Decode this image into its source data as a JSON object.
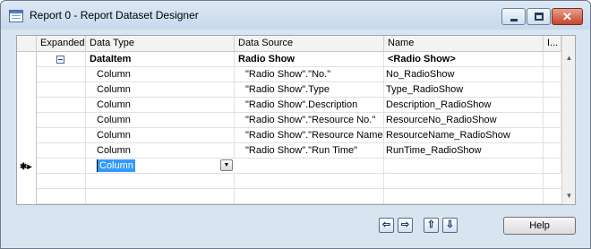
{
  "window": {
    "title": "Report 0 - Report Dataset Designer",
    "icons": {
      "app": "table-icon",
      "minimize": "minimize-icon",
      "maximize": "maximize-icon",
      "close": "close-icon"
    },
    "close_glyph": "✕"
  },
  "grid": {
    "columns": [
      "Expanded",
      "Data Type",
      "Data Source",
      "Name",
      "I..."
    ],
    "rows": [
      {
        "data_type": "DataItem",
        "data_source": "Radio Show",
        "name": "<Radio Show>",
        "expanded": true,
        "bold": true
      },
      {
        "data_type": "Column",
        "data_source": "\"Radio Show\".\"No.\"",
        "name": "No_RadioShow"
      },
      {
        "data_type": "Column",
        "data_source": "\"Radio Show\".Type",
        "name": "Type_RadioShow"
      },
      {
        "data_type": "Column",
        "data_source": "\"Radio Show\".Description",
        "name": "Description_RadioShow"
      },
      {
        "data_type": "Column",
        "data_source": "\"Radio Show\".\"Resource No.\"",
        "name": "ResourceNo_RadioShow"
      },
      {
        "data_type": "Column",
        "data_source": "\"Radio Show\".\"Resource Name\"",
        "name": "ResourceName_RadioShow"
      },
      {
        "data_type": "Column",
        "data_source": "\"Radio Show\".\"Run Time\"",
        "name": "RunTime_RadioShow"
      }
    ],
    "new_row": {
      "marker": "✱▸",
      "data_type": "Column"
    },
    "scroll": {
      "up": "▲",
      "down": "▼"
    },
    "dropdown_glyph": "▼"
  },
  "footer": {
    "nav": [
      {
        "name": "previous-button",
        "glyph": "⇦"
      },
      {
        "name": "next-button",
        "glyph": "⇨"
      },
      {
        "name": "move-up-button",
        "glyph": "⇧"
      },
      {
        "name": "move-down-button",
        "glyph": "⇩"
      }
    ],
    "help_label": "Help"
  },
  "colors": {
    "selection": "#3399ff",
    "window_frame": "#d8e4f0"
  }
}
